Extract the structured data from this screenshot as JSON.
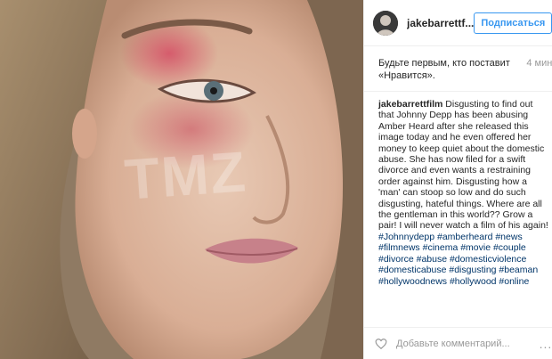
{
  "photo": {
    "watermark": "TMZ"
  },
  "header": {
    "username": "jakebarrettf...",
    "follow_label": "Подписаться"
  },
  "likes": {
    "text": "Будьте первым, кто поставит «Нравится».",
    "time": "4 мин"
  },
  "caption": {
    "user": "jakebarrettfilm",
    "text": "Disgusting to find out that Johnny Depp has been abusing Amber Heard after she released this image today and he even offered her money to keep quiet about the domestic abuse. She has now filed for a swift divorce and even wants a restraining order against him. Disgusting how a 'man' can stoop so low and do such disgusting, hateful things. Where are all the gentleman in this world?? Grow a pair! I will never watch a film of his again!",
    "hashtags": "#Johnnydepp #amberheard #news #filmnews #cinema #movie #couple #divorce #abuse #domesticviolence #domesticabuse #disgusting #beaman #hollywoodnews #hollywood #online"
  },
  "footer": {
    "comment_placeholder": "Добавьте комментарий...",
    "more": "..."
  },
  "colors": {
    "accent": "#3897f0",
    "hashtag": "#003569",
    "muted": "#999999"
  },
  "icons": [
    "heart-icon",
    "more-options-icon"
  ]
}
